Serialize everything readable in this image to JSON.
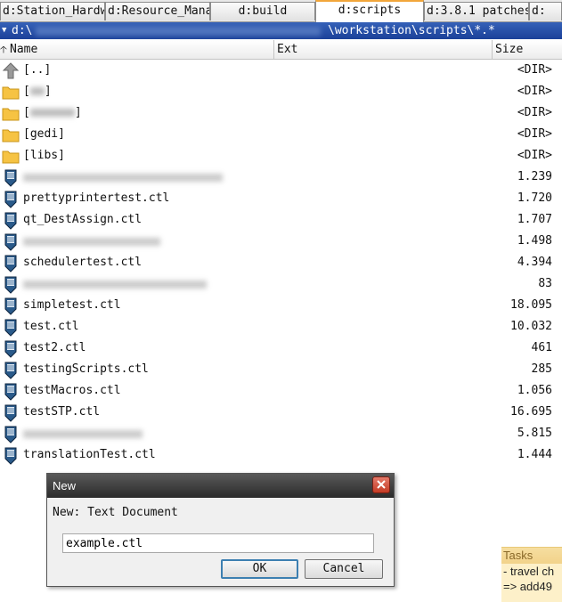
{
  "tabs": [
    {
      "label": "d:Station_Hardw"
    },
    {
      "label": "d:Resource_Mana"
    },
    {
      "label": "d:build"
    },
    {
      "label": "d:scripts"
    },
    {
      "label": "d:3.8.1 patches"
    },
    {
      "label": "d:"
    }
  ],
  "path": {
    "drive": "d:\\",
    "tail": "\\workstation\\scripts\\*.*"
  },
  "columns": {
    "name": "Name",
    "ext": "Ext",
    "size": "Size"
  },
  "rows": [
    {
      "name": "[..]",
      "size": "<DIR>",
      "icon": "up-folder-icon"
    },
    {
      "name": "[",
      "name2": "]",
      "size": "<DIR>",
      "icon": "folder-icon"
    },
    {
      "name": "[",
      "name2": "]",
      "size": "<DIR>",
      "icon": "folder-icon"
    },
    {
      "name": "[gedi]",
      "size": "<DIR>",
      "icon": "folder-icon"
    },
    {
      "name": "[libs]",
      "size": "<DIR>",
      "icon": "folder-icon"
    },
    {
      "name": "",
      "size": "1.239",
      "icon": "script-file-icon"
    },
    {
      "name": "prettyprintertest.ctl",
      "size": "1.720",
      "icon": "script-file-icon"
    },
    {
      "name": "qt_DestAssign.ctl",
      "size": "1.707",
      "icon": "script-file-icon"
    },
    {
      "name": "",
      "size": "1.498",
      "icon": "script-file-icon"
    },
    {
      "name": "schedulertest.ctl",
      "size": "4.394",
      "icon": "script-file-icon"
    },
    {
      "name": "",
      "size": "83",
      "icon": "script-file-icon"
    },
    {
      "name": "simpletest.ctl",
      "size": "18.095",
      "icon": "script-file-icon"
    },
    {
      "name": "test.ctl",
      "size": "10.032",
      "icon": "script-file-icon"
    },
    {
      "name": "test2.ctl",
      "size": "461",
      "icon": "script-file-icon"
    },
    {
      "name": "testingScripts.ctl",
      "size": "285",
      "icon": "script-file-icon"
    },
    {
      "name": "testMacros.ctl",
      "size": "1.056",
      "icon": "script-file-icon"
    },
    {
      "name": "testSTP.ctl",
      "size": "16.695",
      "icon": "script-file-icon"
    },
    {
      "name": "",
      "size": "5.815",
      "icon": "script-file-icon"
    },
    {
      "name": "translationTest.ctl",
      "size": "1.444",
      "icon": "script-file-icon"
    }
  ],
  "dialog": {
    "title": "New",
    "message": "New: Text Document",
    "input_value": "example.ctl",
    "ok_label": "OK",
    "cancel_label": "Cancel"
  },
  "tasks": {
    "title": "Tasks",
    "lines": [
      "- travel ch",
      "=> add49"
    ]
  },
  "colors": {
    "active_tab_accent": "#f2a63a",
    "path_bar": "#1c4199",
    "dialog_title": "#2b2b2b",
    "tasks_bg": "#fdf0c9"
  }
}
